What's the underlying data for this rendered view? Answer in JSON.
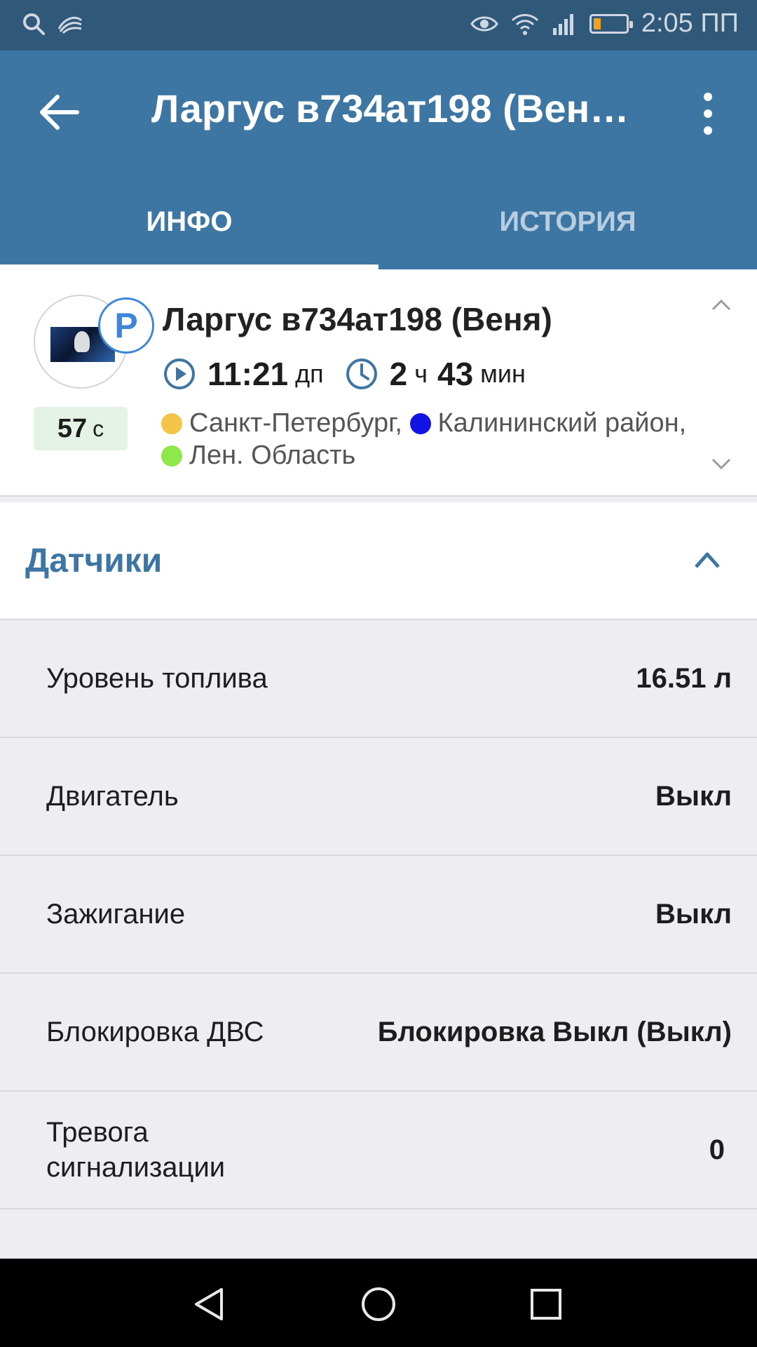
{
  "status_bar": {
    "time": "2:05 ПП",
    "battery_level": 0.15,
    "icons": [
      "search-icon",
      "swype-icon",
      "eye-icon",
      "wifi-icon",
      "signal-icon",
      "battery-icon"
    ]
  },
  "toolbar": {
    "title": "Ларгус в734ат198 (Вен…"
  },
  "tabs": [
    {
      "label": "ИНФО",
      "active": true
    },
    {
      "label": "ИСТОРИЯ",
      "active": false
    }
  ],
  "vehicle": {
    "name": "Ларгус в734ат198 (Веня)",
    "status_letter": "P",
    "time_value": "11:21",
    "time_suffix": "дп",
    "duration_hours": "2",
    "duration_hours_unit": "ч",
    "duration_minutes": "43",
    "duration_minutes_unit": "мин",
    "age_value": "57",
    "age_unit": "с",
    "geozones": [
      {
        "name": "Санкт-Петербург,",
        "color": "#f2c448"
      },
      {
        "name": "Калининский район,",
        "color": "#1313e6"
      },
      {
        "name": "Лен. Область",
        "color": "#8ee84b"
      }
    ]
  },
  "sensors": {
    "title": "Датчики",
    "rows": [
      {
        "label": "Уровень топлива",
        "value": "16.51 л"
      },
      {
        "label": "Двигатель",
        "value": "Выкл"
      },
      {
        "label": "Зажигание",
        "value": "Выкл"
      },
      {
        "label": "Блокировка ДВС",
        "value": "Блокировка Выкл (Выкл)"
      },
      {
        "label": "Тревога сигнализации",
        "value": "0"
      }
    ]
  },
  "colors": {
    "primary": "#3e76a3",
    "status_bar": "#2f5879",
    "parking_badge": "#3e86d8",
    "timer_badge_bg": "#e4f3e6"
  }
}
